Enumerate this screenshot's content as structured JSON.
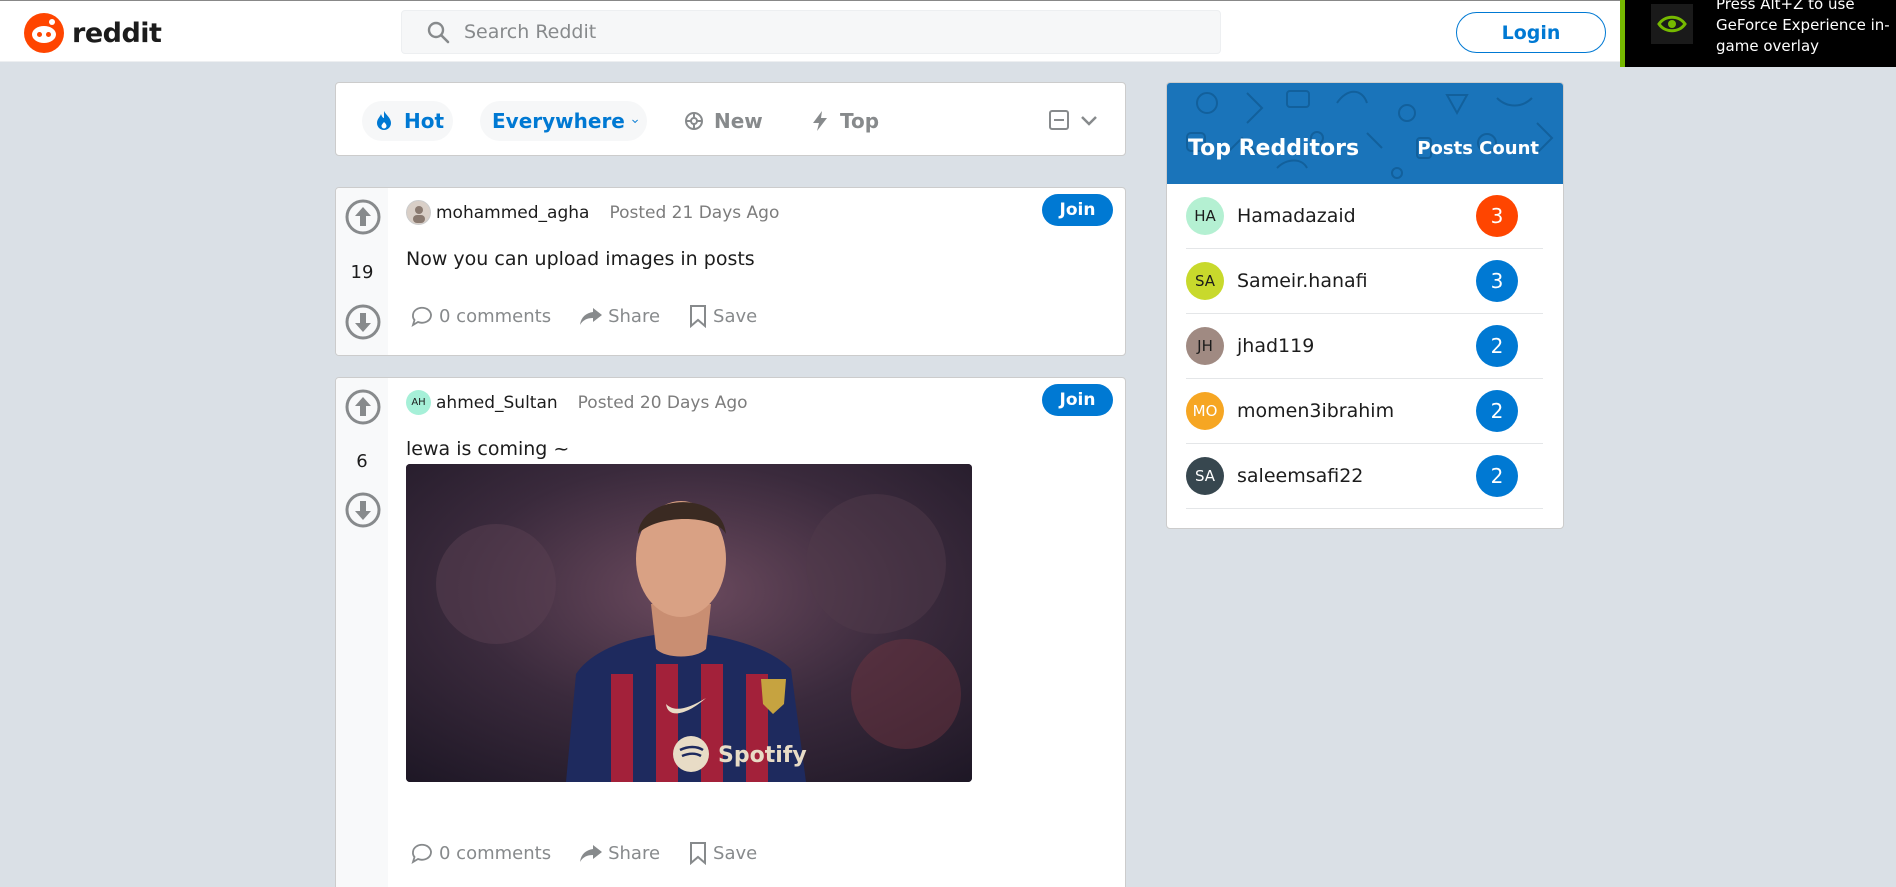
{
  "header": {
    "logo_text": "reddit",
    "search_placeholder": "Search Reddit",
    "login_label": "Login",
    "overlay_text": "Press Alt+Z to use GeForce Experience in-game overlay",
    "overlay_icon": "nvidia-icon"
  },
  "sortbar": {
    "hot_label": "Hot",
    "everywhere_label": "Everywhere",
    "new_label": "New",
    "top_label": "Top"
  },
  "colors": {
    "brand": "#ff4500",
    "accent": "#0079d3",
    "sidebar_header": "#1a74ba"
  },
  "posts": [
    {
      "username": "mohammed_agha",
      "posted": "Posted 21 Days Ago",
      "join_label": "Join",
      "votes": "19",
      "title": "Now you can upload images in posts",
      "comments": "0 comments",
      "share": "Share",
      "save": "Save"
    },
    {
      "avatar_initials": "AH",
      "username": "ahmed_Sultan",
      "posted": "Posted 20 Days Ago",
      "join_label": "Join",
      "votes": "6",
      "title": "lewa is coming ~",
      "image_text": "Spotify",
      "comments": "0 comments",
      "share": "Share",
      "save": "Save"
    }
  ],
  "sidebar": {
    "title": "Top Redditors",
    "count_header": "Posts Count",
    "redditors": [
      {
        "initials": "HA",
        "name": "Hamadazaid",
        "count": "3",
        "avatar_color": "#b4f0d2",
        "count_color": "#ff4500"
      },
      {
        "initials": "SA",
        "name": "Sameir.hanafi",
        "count": "3",
        "avatar_color": "#c8d92c",
        "count_color": "#0079d3"
      },
      {
        "initials": "JH",
        "name": "jhad119",
        "count": "2",
        "avatar_color": "#a08a82",
        "count_color": "#0079d3"
      },
      {
        "initials": "MO",
        "name": "momen3ibrahim",
        "count": "2",
        "avatar_color": "#f6a623",
        "count_color": "#0079d3"
      },
      {
        "initials": "SA",
        "name": "saleemsafi22",
        "count": "2",
        "avatar_color": "#37474f",
        "count_color": "#0079d3"
      }
    ]
  }
}
